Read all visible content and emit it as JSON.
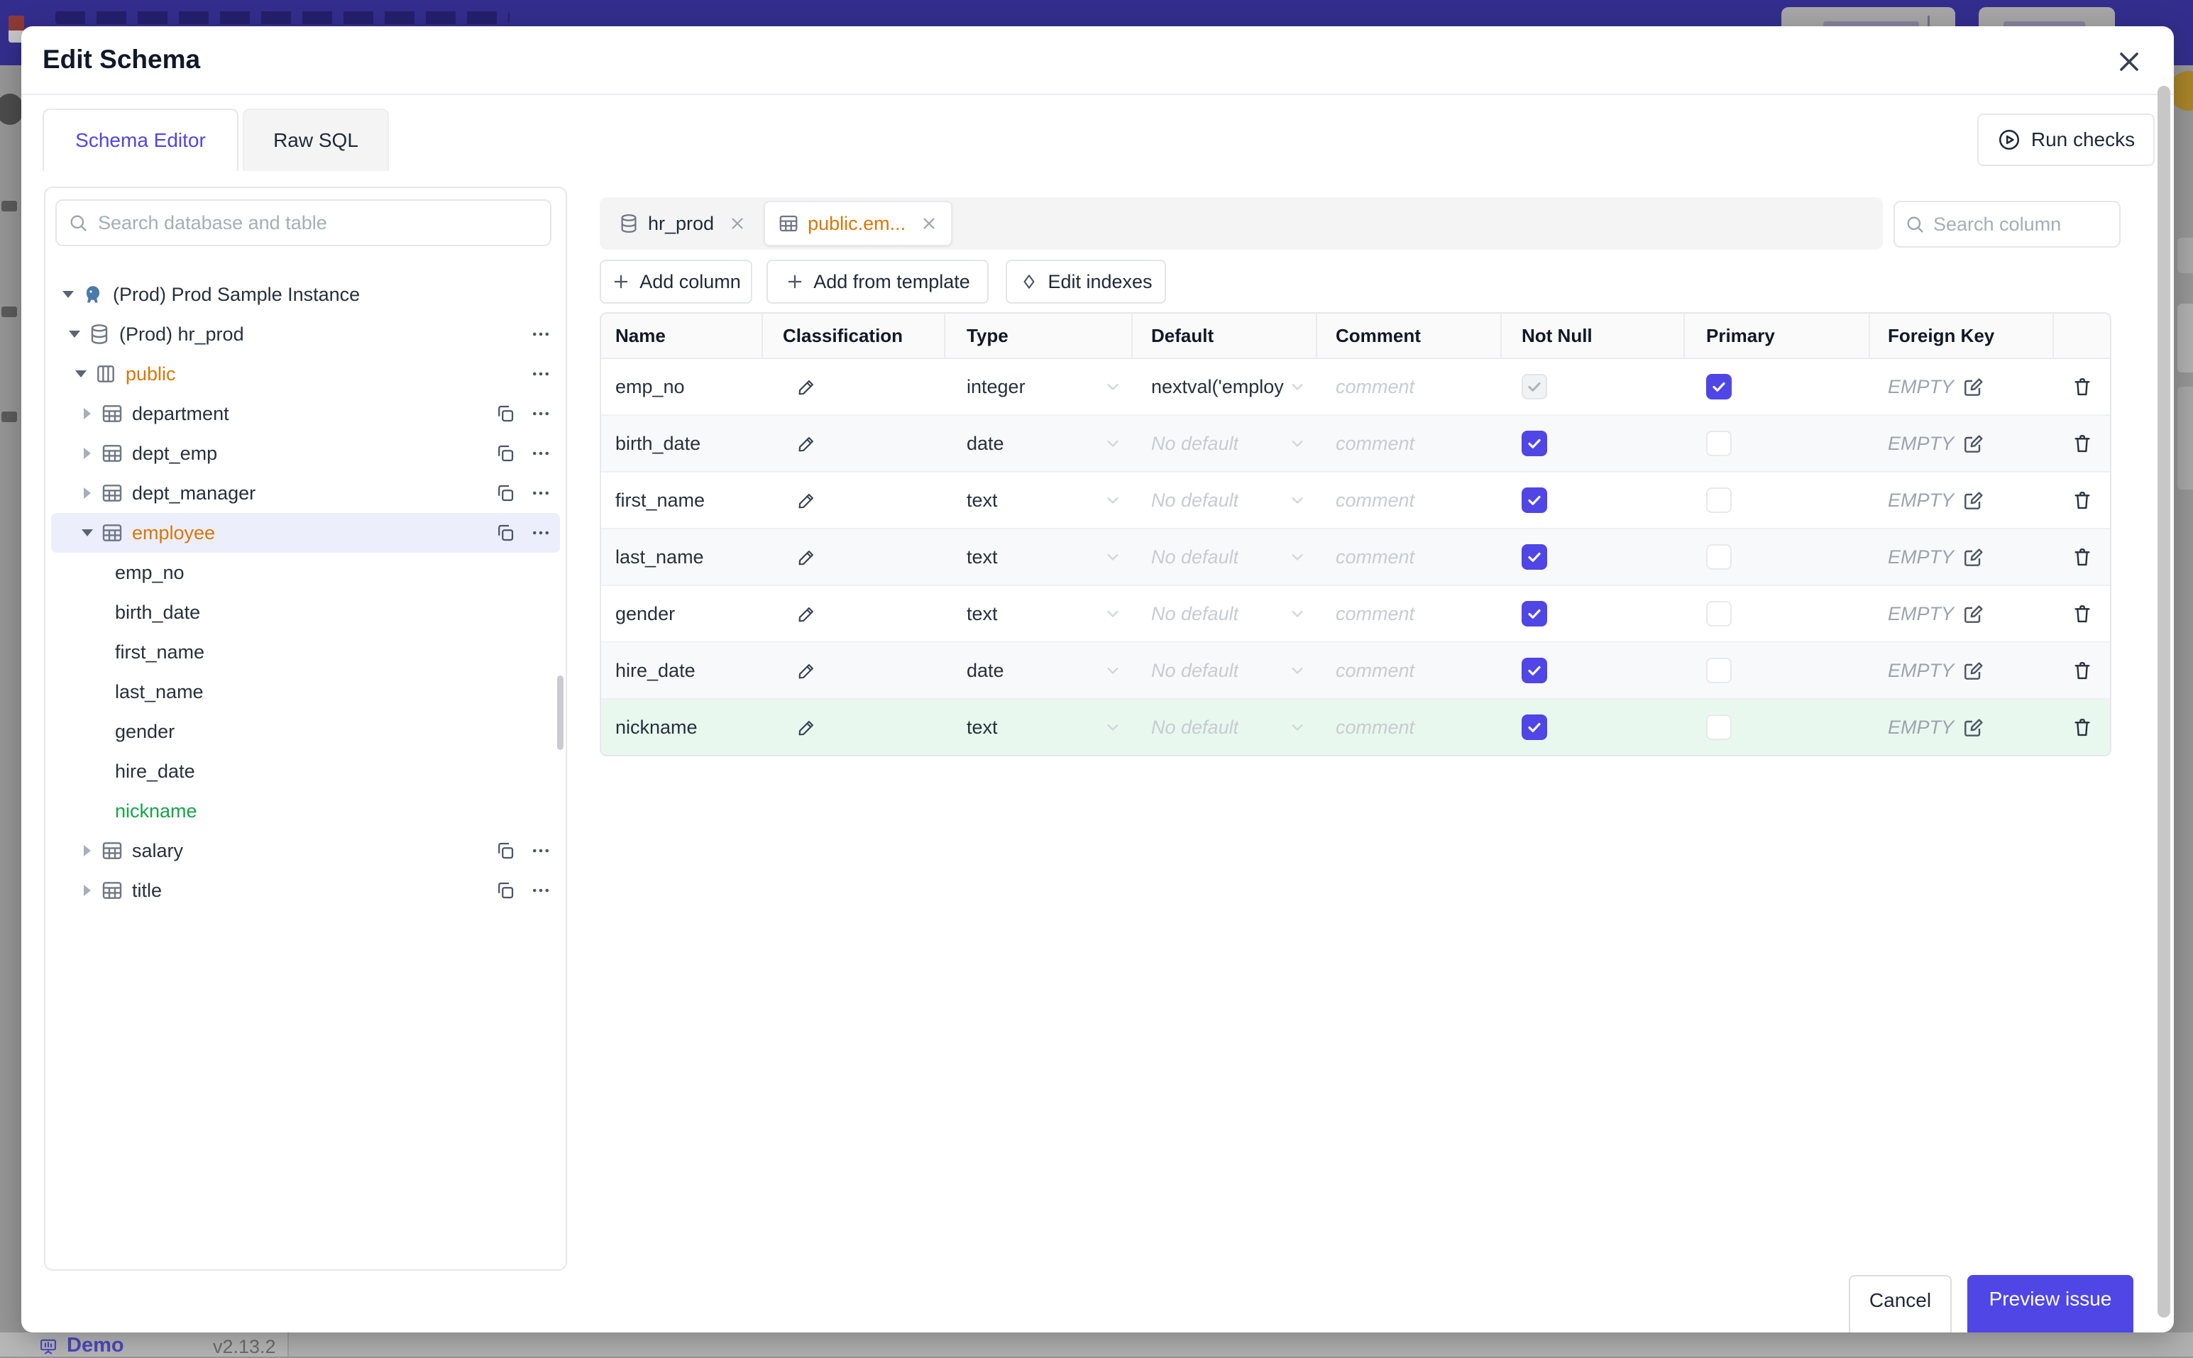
{
  "colors": {
    "accent": "#4f46e5",
    "schema_orange": "#d97706",
    "new_green": "#16a34a",
    "new_row_bg": "#e8f8ee",
    "topbar": "#332e8d"
  },
  "backdrop": {
    "demo_label": "Demo",
    "version_label": "v2.13.2"
  },
  "modal": {
    "title": "Edit Schema",
    "tabs": {
      "schema_editor": "Schema Editor",
      "raw_sql": "Raw SQL"
    },
    "run_checks": "Run checks",
    "sidebar": {
      "search_placeholder": "Search database and table",
      "instance_label": "(Prod) Prod Sample Instance",
      "database_label": "(Prod) hr_prod",
      "schema_label": "public",
      "tables_before": [
        "department",
        "dept_emp",
        "dept_manager"
      ],
      "selected_table": "employee",
      "columns": [
        "emp_no",
        "birth_date",
        "first_name",
        "last_name",
        "gender",
        "hire_date"
      ],
      "new_column": "nickname",
      "tables_after": [
        "salary",
        "title"
      ]
    },
    "editor": {
      "db_tab": "hr_prod",
      "table_tab": "public.em...",
      "add_column": "Add column",
      "add_from_template": "Add from template",
      "edit_indexes": "Edit indexes",
      "search_placeholder": "Search column",
      "table": {
        "headers": [
          "Name",
          "Classification",
          "Type",
          "Default",
          "Comment",
          "Not Null",
          "Primary",
          "Foreign Key"
        ],
        "comment_placeholder": "comment",
        "fk_empty": "EMPTY",
        "rows": [
          {
            "name": "emp_no",
            "type": "integer",
            "default": "nextval('employ",
            "default_state": "value",
            "not_null": "disabled",
            "primary": "checked",
            "state": "normal"
          },
          {
            "name": "birth_date",
            "type": "date",
            "default": "No default",
            "default_state": "placeholder",
            "not_null": "checked",
            "primary": "unchecked",
            "state": "even"
          },
          {
            "name": "first_name",
            "type": "text",
            "default": "No default",
            "default_state": "placeholder",
            "not_null": "checked",
            "primary": "unchecked",
            "state": "normal"
          },
          {
            "name": "last_name",
            "type": "text",
            "default": "No default",
            "default_state": "placeholder",
            "not_null": "checked",
            "primary": "unchecked",
            "state": "even"
          },
          {
            "name": "gender",
            "type": "text",
            "default": "No default",
            "default_state": "placeholder",
            "not_null": "checked",
            "primary": "unchecked",
            "state": "normal"
          },
          {
            "name": "hire_date",
            "type": "date",
            "default": "No default",
            "default_state": "placeholder",
            "not_null": "checked",
            "primary": "unchecked",
            "state": "even"
          },
          {
            "name": "nickname",
            "type": "text",
            "default": "No default",
            "default_state": "placeholder",
            "not_null": "checked",
            "primary": "unchecked",
            "state": "new"
          }
        ]
      }
    },
    "footer": {
      "cancel": "Cancel",
      "preview": "Preview issue"
    }
  }
}
